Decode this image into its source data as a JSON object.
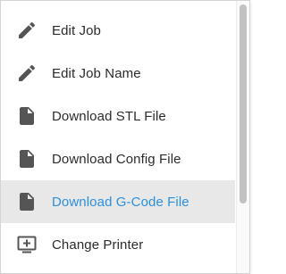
{
  "menu": {
    "items": [
      {
        "label": "Edit Job",
        "icon": "pencil-icon"
      },
      {
        "label": "Edit Job Name",
        "icon": "pencil-icon"
      },
      {
        "label": "Download STL File",
        "icon": "file-icon"
      },
      {
        "label": "Download Config File",
        "icon": "file-icon"
      },
      {
        "label": "Download G-Code File",
        "icon": "file-icon",
        "highlighted": true
      },
      {
        "label": "Change Printer",
        "icon": "monitor-add-icon"
      }
    ],
    "highlight_color": "#2c8fde",
    "text_color": "#2b2b2b",
    "icon_color": "#555555"
  }
}
